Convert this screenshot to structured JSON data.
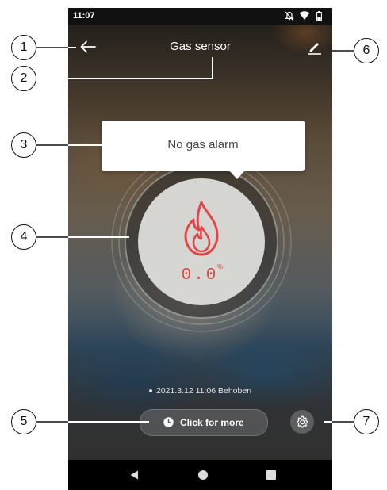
{
  "status_bar": {
    "time": "11:07",
    "icons": [
      "notifications-off-icon",
      "wifi-icon",
      "battery-icon"
    ]
  },
  "header": {
    "title": "Gas sensor",
    "back_icon": "arrow-left-icon",
    "edit_icon": "pencil-icon"
  },
  "alarm": {
    "message": "No gas alarm",
    "reading": "0.0",
    "unit": "%",
    "icon": "flame-icon",
    "accent_color": "#e0464a"
  },
  "history": {
    "entry": "2021.3.12 11:06 Behoben"
  },
  "actions": {
    "more_label": "Click for more",
    "more_icon": "clock-icon",
    "settings_icon": "gear-icon"
  },
  "nav": [
    "back-triangle-icon",
    "home-circle-icon",
    "recents-square-icon"
  ],
  "callouts": [
    "1",
    "2",
    "3",
    "4",
    "5",
    "6",
    "7"
  ]
}
